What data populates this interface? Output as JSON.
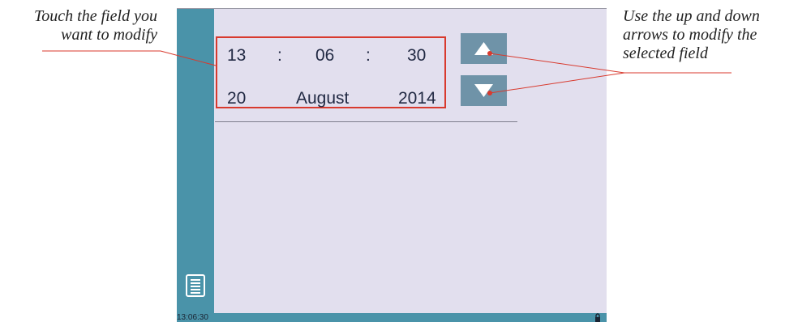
{
  "annotations": {
    "left": [
      "Touch the field you",
      "want to modify"
    ],
    "right": [
      "Use the up and down",
      "arrows to modify the",
      "selected field"
    ]
  },
  "time": {
    "hour": "13",
    "minute": "06",
    "second": "30",
    "separator": ":"
  },
  "date": {
    "day": "20",
    "month": "August",
    "year": "2014"
  },
  "buttons": {
    "up": "up-arrow-icon",
    "down": "down-arrow-icon"
  },
  "status": {
    "time": "13:06:30"
  },
  "icons": {
    "menu": "menu-list-icon",
    "lock": "lock-icon"
  },
  "colors": {
    "screen_bg": "#e2dfee",
    "sidebar": "#4a93a9",
    "arrow_button": "#6f93a8",
    "highlight": "#d83a2e"
  }
}
